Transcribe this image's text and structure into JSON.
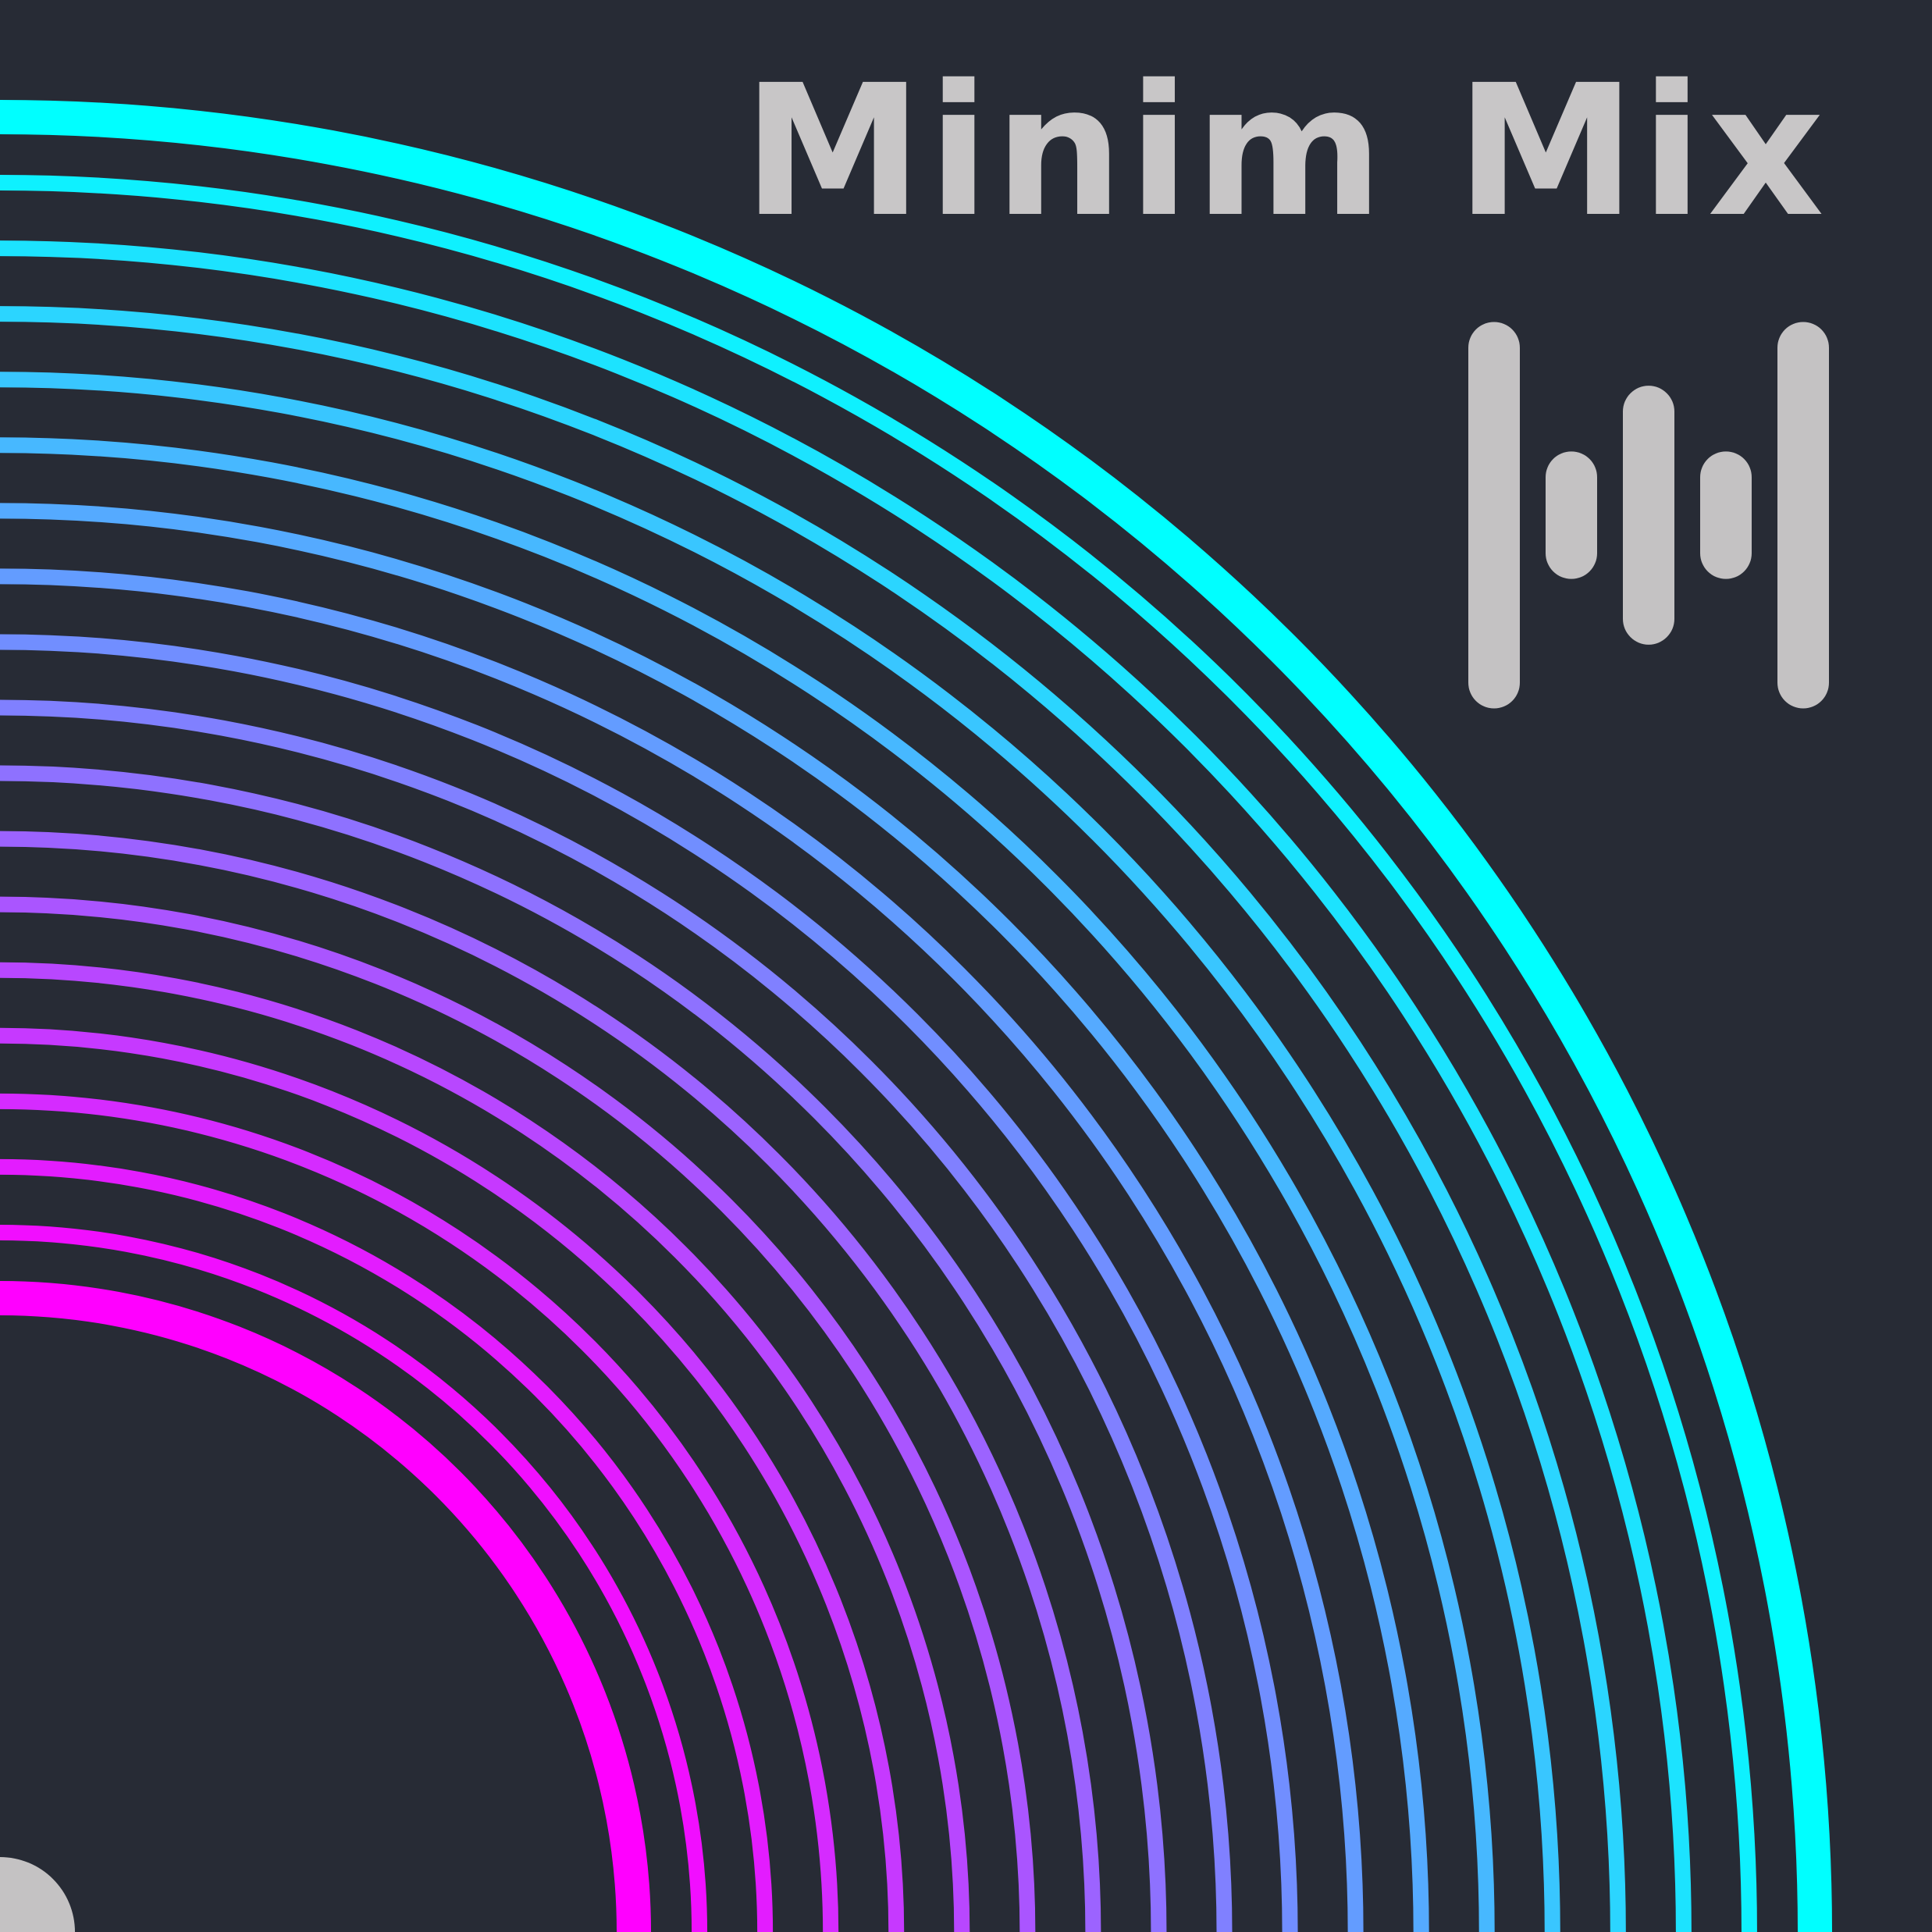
{
  "title": "Minim Mix",
  "colors": {
    "background": "#272b35",
    "title": "#c8c6c7",
    "logo": "#c4c2c3",
    "arc_outer": "#00ffff",
    "arc_inner": "#ff00ff"
  },
  "logo": {
    "icon": "equalizer-bars-icon",
    "bar_levels": [
      1.0,
      0.33,
      0.67,
      0.33,
      1.0
    ]
  }
}
